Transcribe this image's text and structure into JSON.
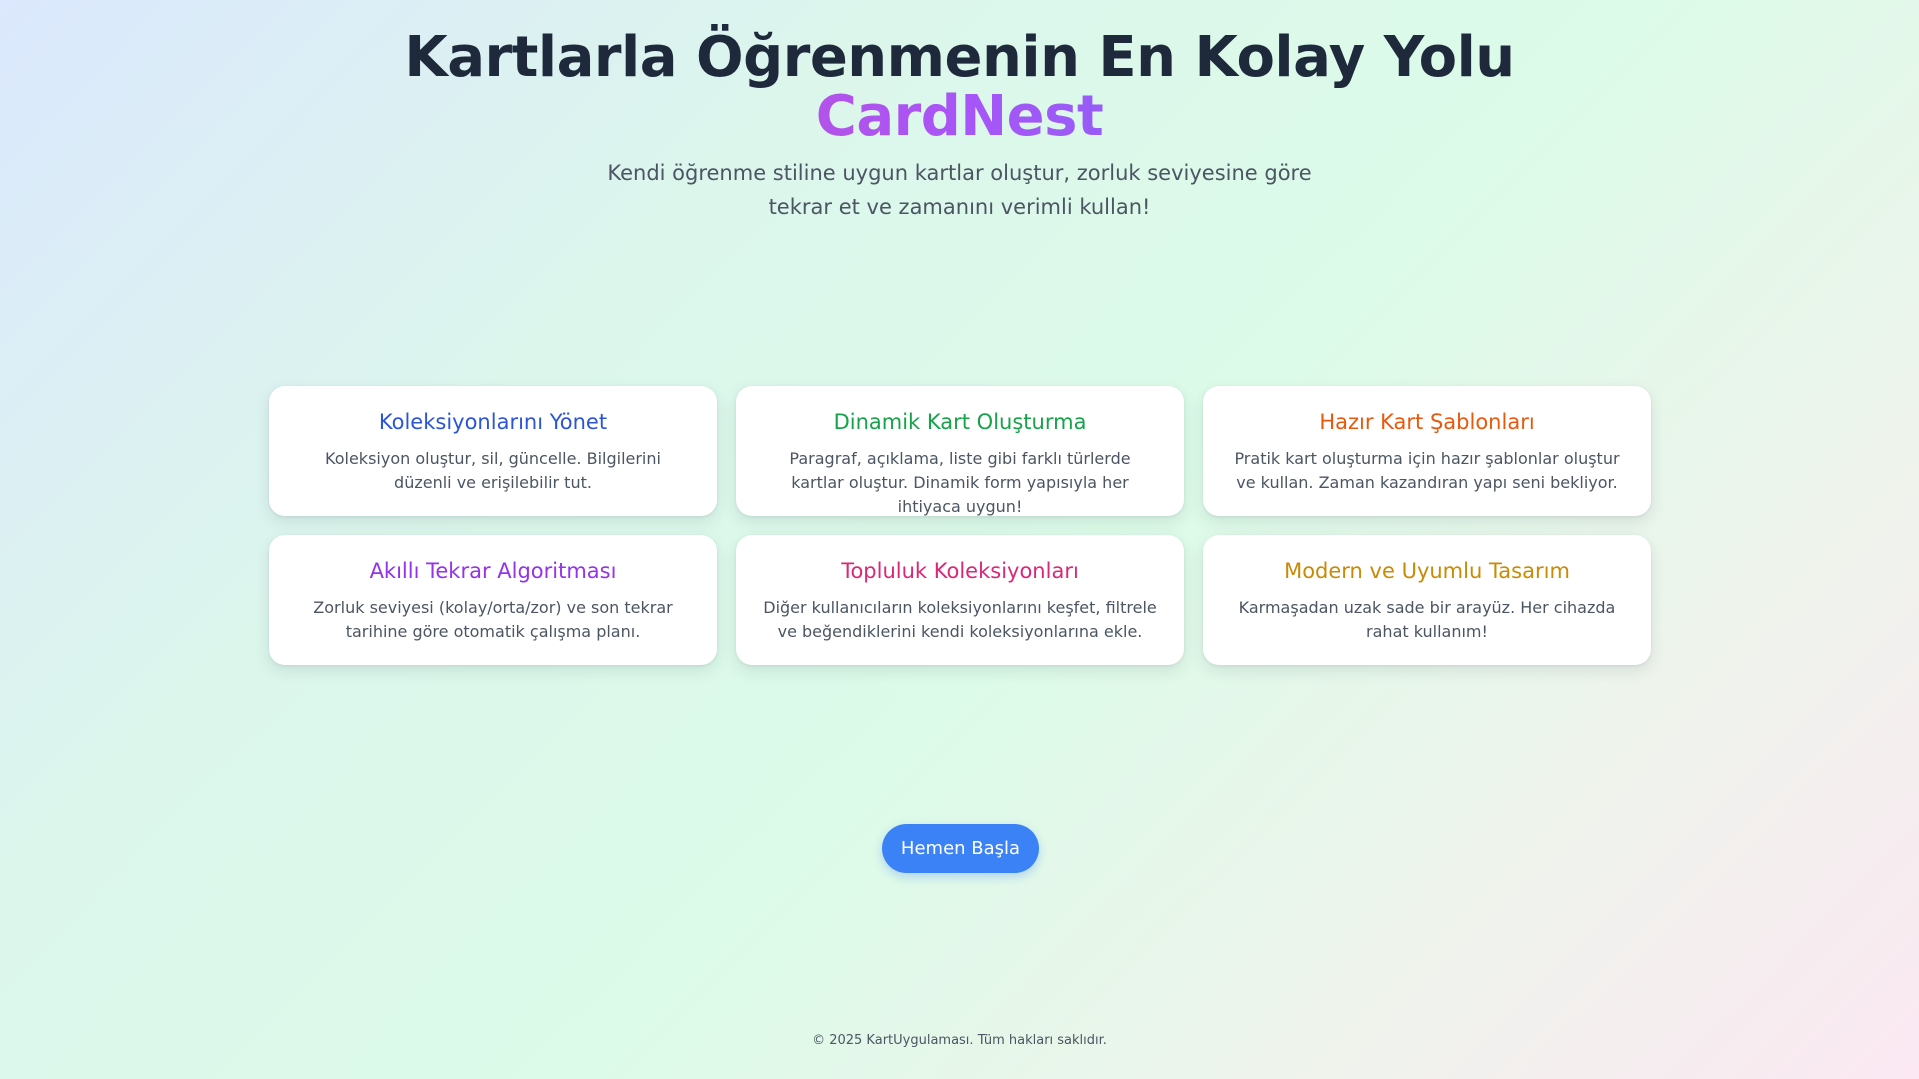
{
  "hero": {
    "title": "Kartlarla Öğrenmenin En Kolay Yolu",
    "brand": "CardNest",
    "subtitle": "Kendi öğrenme stiline uygun kartlar oluştur, zorluk seviyesine göre tekrar et ve zamanını verimli kullan!"
  },
  "colors": {
    "brand_gradient": [
      "#ec4899",
      "#a855f7",
      "#3b82f6"
    ],
    "button": "#3b82f6"
  },
  "features": [
    {
      "title": "Koleksiyonlarını Yönet",
      "description": "Koleksiyon oluştur, sil, güncelle. Bilgilerini düzenli ve erişilebilir tut.",
      "color": "#2b55d6"
    },
    {
      "title": "Dinamik Kart Oluşturma",
      "description": "Paragraf, açıklama, liste gibi farklı türlerde kartlar oluştur. Dinamik form yapısıyla her ihtiyaca uygun!",
      "color": "#16a34a"
    },
    {
      "title": "Hazır Kart Şablonları",
      "description": "Pratik kart oluşturma için hazır şablonlar oluştur ve kullan. Zaman kazandıran yapı seni bekliyor.",
      "color": "#ea580c"
    },
    {
      "title": "Akıllı Tekrar Algoritması",
      "description": "Zorluk seviyesi (kolay/orta/zor) ve son tekrar tarihine göre otomatik çalışma planı.",
      "color": "#9333ea"
    },
    {
      "title": "Topluluk Koleksiyonları",
      "description": "Diğer kullanıcıların koleksiyonlarını keşfet, filtrele ve beğendiklerini kendi koleksiyonlarına ekle.",
      "color": "#db2777"
    },
    {
      "title": "Modern ve Uyumlu Tasarım",
      "description": "Karmaşadan uzak sade bir arayüz. Her cihazda rahat kullanım!",
      "color": "#ca8a04"
    }
  ],
  "cta": {
    "label": "Hemen Başla"
  },
  "footer": {
    "text": "© 2025 KartUygulaması. Tüm hakları saklıdır."
  }
}
